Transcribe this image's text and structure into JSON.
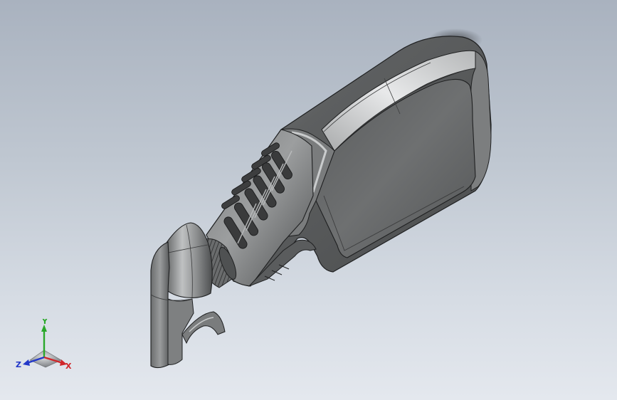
{
  "viewport": {
    "background_top": "#a9b2bf",
    "background_bottom": "#e4e8ee"
  },
  "model": {
    "body_color": "#6a6c6d",
    "highlight_color": "#c9cbcc",
    "edge_color": "#1f2021"
  },
  "triad": {
    "x_label": "X",
    "y_label": "Y",
    "z_label": "Z",
    "x_color": "#d0262a",
    "y_color": "#2aa82a",
    "z_color": "#2338c8"
  }
}
